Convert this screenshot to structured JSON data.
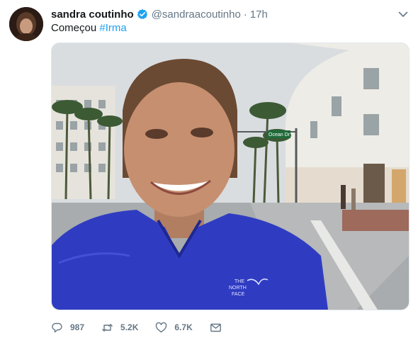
{
  "author": {
    "display_name": "sandra coutinho",
    "handle": "@sandraacoutinho",
    "separator": "·",
    "time": "17h",
    "verified": true
  },
  "tweet": {
    "text": "Começou ",
    "hashtag": "#Irma"
  },
  "media": {
    "street_sign": "Ocean Dr",
    "jacket_logo_line1": "THE",
    "jacket_logo_line2": "NORTH",
    "jacket_logo_line3": "FACE"
  },
  "actions": {
    "reply_count": "987",
    "retweet_count": "5.2K",
    "like_count": "6.7K"
  },
  "icons": {
    "reply": "reply-icon",
    "retweet": "retweet-icon",
    "like": "heart-icon",
    "dm": "envelope-icon",
    "more": "chevron-down-icon",
    "verified": "verified-badge-icon"
  },
  "colors": {
    "link": "#1da1f2",
    "secondary_text": "#657786",
    "primary_text": "#14171a",
    "jacket": "#2f3cc2"
  }
}
